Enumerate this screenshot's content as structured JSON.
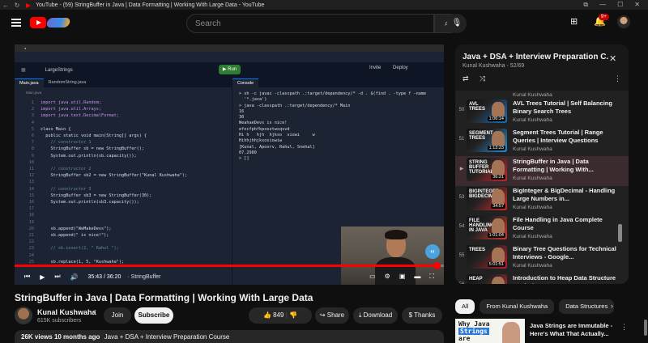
{
  "browser": {
    "title": "YouTube - (59) StringBuffer in Java | Data Formatting | Working With Large Data - YouTube"
  },
  "header": {
    "search_placeholder": "Search",
    "notifications": "9+"
  },
  "player": {
    "ide_project": "LargeStrings",
    "run_label": "Run",
    "invite_label": "Invite",
    "deploy_label": "Deploy",
    "tabs": [
      "Main.java",
      "RandomString.java"
    ],
    "console_tab": "Console",
    "breadcrumb": "Main.java",
    "time": "35:43 / 36:20",
    "chapter": "· StringBuffer",
    "progress": 0.983
  },
  "video": {
    "title": "StringBuffer in Java | Data Formatting | Working With Large Data",
    "channel": "Kunal Kushwaha",
    "subscribers": "615K subscribers",
    "join": "Join",
    "subscribe": "Subscribe",
    "likes": "849",
    "share": "Share",
    "download": "Download",
    "thanks": "Thanks",
    "views": "26K views",
    "age": "10 months ago",
    "playlist_link": "Java + DSA + Interview Preparation Course"
  },
  "playlist": {
    "title": "Java + DSA + Interview Preparation C...",
    "subtitle": "Kunal Kushwaha - 52/69",
    "top_channel": "Kunal Kushwaha",
    "items": [
      {
        "num": "50",
        "title": "AVL Trees Tutorial | Self Balancing Binary Search Trees",
        "channel": "Kunal Kushwaha",
        "duration": "1:06:14",
        "thumb_text": "AVL TREES",
        "color": "#1e6fb5"
      },
      {
        "num": "51",
        "title": "Segment Trees Tutorial | Range Queries | Interview Questions",
        "channel": "Kunal Kushwaha",
        "duration": "1:13:23",
        "thumb_text": "SEGMENT TREES",
        "color": "#2b8fd6"
      },
      {
        "num": "▶",
        "title": "StringBuffer in Java | Data Formatting | Working With...",
        "channel": "Kunal Kushwaha",
        "duration": "36:21",
        "thumb_text": "STRING BUFFER TUTORIAL",
        "color": "#c8282e"
      },
      {
        "num": "53",
        "title": "BigInteger & BigDecimal - Handling Large Numbers in...",
        "channel": "Kunal Kushwaha",
        "duration": "34:57",
        "thumb_text": "BIGINTEGER BIGDECIMAL",
        "color": "#d12a2a"
      },
      {
        "num": "54",
        "title": "File Handling in Java Complete Course",
        "channel": "Kunal Kushwaha",
        "duration": "1:01:04",
        "thumb_text": "FILE HANDLING IN JAVA",
        "color": "#d33a2c"
      },
      {
        "num": "55",
        "title": "Binary Tree Questions for Technical Interviews - Google...",
        "channel": "Kunal Kushwaha",
        "duration": "5:01:51",
        "thumb_text": "TREES",
        "color": "#b8232a"
      },
      {
        "num": "56",
        "title": "Introduction to Heap Data Structure + Priority Queue +...",
        "channel": "Kunal Kushwaha",
        "duration": "",
        "thumb_text": "HEAP",
        "color": "#c8282e"
      }
    ]
  },
  "chips": [
    "All",
    "From Kunal Kushwaha",
    "Data Structures"
  ],
  "recommendation": {
    "title": "Java Strings are Immutable - Here's What That Actually...",
    "line1": "Why Java",
    "line2": "Strings",
    "line3": "are"
  },
  "code": [
    [
      "import java.util.Random;"
    ],
    [
      "import java.util.Arrays;"
    ],
    [
      "import java.text.DecimalFormat;"
    ],
    [
      ""
    ],
    [
      "class Main {"
    ],
    [
      "  public static void main(String[] args) {"
    ],
    [
      "    // constructor 1"
    ],
    [
      "    StringBuffer sb = new StringBuffer();"
    ],
    [
      "    System.out.println(sb.capacity());"
    ],
    [
      ""
    ],
    [
      "    // constructor 2"
    ],
    [
      "    StringBuffer sb2 = new StringBuffer(\"Kunal Kushwaha\");"
    ],
    [
      ""
    ],
    [
      "    // constructor 3"
    ],
    [
      "    StringBuffer sb3 = new StringBuffer(30);"
    ],
    [
      "    System.out.println(sb3.capacity());"
    ],
    [
      ""
    ],
    [
      ""
    ],
    [
      ""
    ],
    [
      "    sb.append(\"WeMakeDevs\");"
    ],
    [
      "    sb.append(\" is nice!\");"
    ],
    [
      ""
    ],
    [
      "    // sb.insert(2, \" Rahul \");"
    ],
    [
      ""
    ],
    [
      "    sb.replace(1, 5, \"Kushwaha\");"
    ]
  ],
  "console": [
    "> sh -c javac -classpath .:target/dependency/* -d . $(find . -type f -name",
    "  '*.java')",
    "> java -classpath .:target/dependency/* Main",
    "16",
    "30",
    "WeahaeDevs is nice!",
    "efocfphfkpxoztwsqsvd",
    "Hi h   hjh  hjkso  siowi     w",
    "Hihhjhhjksosiowiw",
    "[Kunal, Apoorv, Rahul, Snehal]",
    "07.2980",
    "> []"
  ]
}
